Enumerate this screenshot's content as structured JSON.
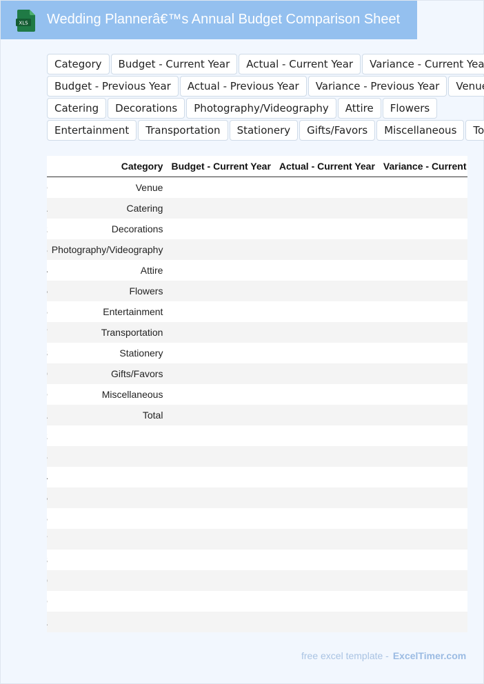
{
  "header": {
    "title": "Wedding Plannerâ€™s Annual Budget Comparison Sheet",
    "icon_label": "XLS",
    "icon": "spreadsheet-file-icon",
    "bg_color": "#94c0ef",
    "icon_color": "#1f7a45"
  },
  "chips": [
    [
      "Category",
      "Budget - Current Year",
      "Actual - Current Year",
      "Variance - Current Year"
    ],
    [
      "Budget - Previous Year",
      "Actual - Previous Year",
      "Variance - Previous Year",
      "Venue"
    ],
    [
      "Catering",
      "Decorations",
      "Photography/Videography",
      "Attire",
      "Flowers"
    ],
    [
      "Entertainment",
      "Transportation",
      "Stationery",
      "Gifts/Favors",
      "Miscellaneous",
      "Total"
    ]
  ],
  "table": {
    "columns": [
      "Category",
      "Budget - Current Year",
      "Actual - Current Year",
      "Variance - Current Year"
    ],
    "rows": [
      {
        "index": "0",
        "category": "Venue"
      },
      {
        "index": "1",
        "category": "Catering"
      },
      {
        "index": "2",
        "category": "Decorations"
      },
      {
        "index": "3",
        "category": "Photography/Videography"
      },
      {
        "index": "4",
        "category": "Attire"
      },
      {
        "index": "5",
        "category": "Flowers"
      },
      {
        "index": "6",
        "category": "Entertainment"
      },
      {
        "index": "7",
        "category": "Transportation"
      },
      {
        "index": "8",
        "category": "Stationery"
      },
      {
        "index": "9",
        "category": "Gifts/Favors"
      },
      {
        "index": "0",
        "category": "Miscellaneous"
      },
      {
        "index": "1",
        "category": "Total"
      },
      {
        "index": "2",
        "category": ""
      },
      {
        "index": "3",
        "category": ""
      },
      {
        "index": "4",
        "category": ""
      },
      {
        "index": "5",
        "category": ""
      },
      {
        "index": "6",
        "category": ""
      },
      {
        "index": "7",
        "category": ""
      },
      {
        "index": "8",
        "category": ""
      },
      {
        "index": "9",
        "category": ""
      },
      {
        "index": "0",
        "category": ""
      },
      {
        "index": "1",
        "category": ""
      }
    ]
  },
  "footer": {
    "prefix": "free excel template -",
    "brand": "ExcelTimer.com"
  }
}
